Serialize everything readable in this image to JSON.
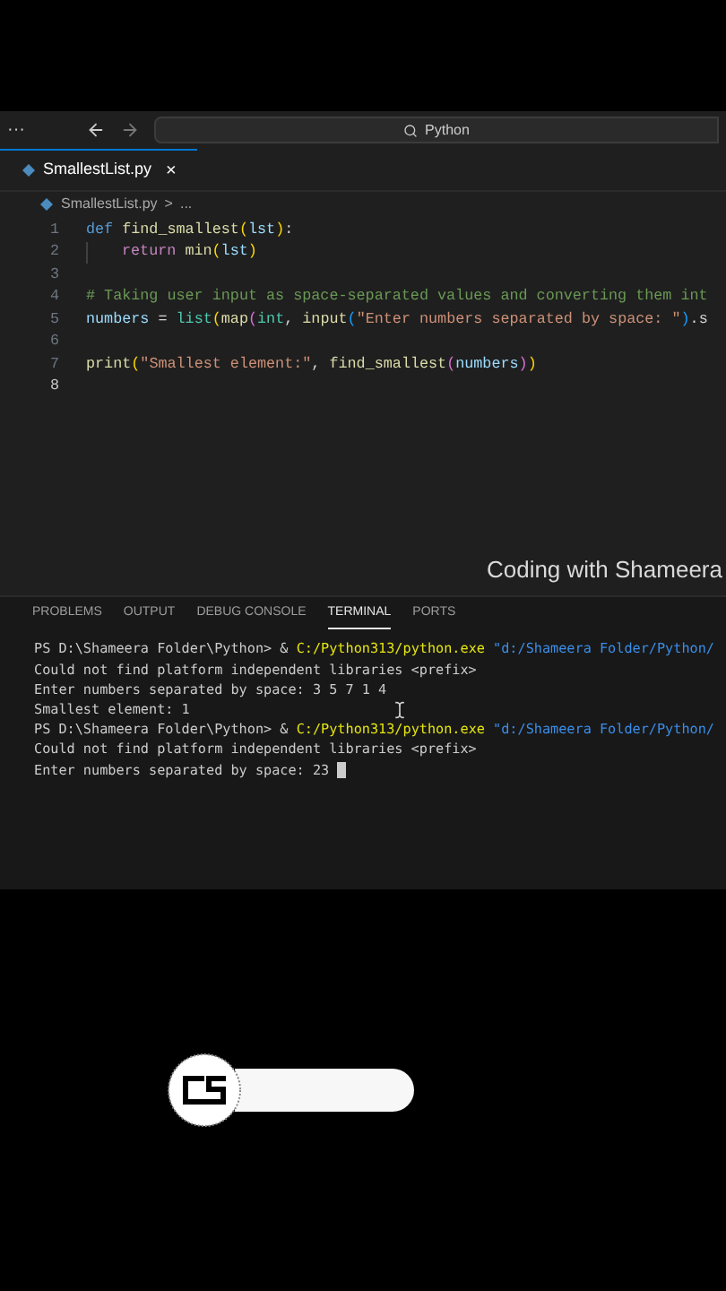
{
  "title_bar": {
    "menu": "···",
    "search": "Python"
  },
  "tabs": [
    {
      "label": "SmallestList.py",
      "selected": true,
      "close": "×"
    }
  ],
  "breadcrumb": {
    "file": "SmallestList.py",
    "separator": ">",
    "rest": "..."
  },
  "code": [
    {
      "number": "1",
      "current": false,
      "tokens": [
        {
          "kind": "keyword",
          "text": "def "
        },
        {
          "kind": "function",
          "text": "find_smallest"
        },
        {
          "kind": "bracket",
          "text": "("
        },
        {
          "kind": "variable",
          "text": "lst"
        },
        {
          "kind": "bracket",
          "text": ")"
        },
        {
          "kind": "plain",
          "text": ":"
        }
      ]
    },
    {
      "number": "2",
      "current": false,
      "indent": true,
      "tokens": [
        {
          "kind": "control",
          "text": "return "
        },
        {
          "kind": "function",
          "text": "min"
        },
        {
          "kind": "bracket",
          "text": "("
        },
        {
          "kind": "variable",
          "text": "lst"
        },
        {
          "kind": "bracket",
          "text": ")"
        }
      ]
    },
    {
      "number": "3",
      "current": false
    },
    {
      "number": "4",
      "current": false,
      "tokens": [
        {
          "kind": "comment",
          "text": "# Taking user input as space-separated values and converting them int"
        }
      ]
    },
    {
      "number": "5",
      "current": false,
      "tokens": [
        {
          "kind": "variable",
          "text": "numbers"
        },
        {
          "kind": "plain",
          "text": " = "
        },
        {
          "kind": "type",
          "text": "list"
        },
        {
          "kind": "bracket",
          "text": "("
        },
        {
          "kind": "function",
          "text": "map"
        },
        {
          "kind": "bracket2",
          "text": "("
        },
        {
          "kind": "type",
          "text": "int"
        },
        {
          "kind": "plain",
          "text": ", "
        },
        {
          "kind": "function",
          "text": "input"
        },
        {
          "kind": "bracket3",
          "text": "("
        },
        {
          "kind": "string",
          "text": "\"Enter numbers separated by space: \""
        },
        {
          "kind": "bracket3",
          "text": ")"
        },
        {
          "kind": "plain",
          "text": ".s"
        }
      ]
    },
    {
      "number": "6",
      "current": false
    },
    {
      "number": "7",
      "current": false,
      "tokens": [
        {
          "kind": "function",
          "text": "print"
        },
        {
          "kind": "bracket",
          "text": "("
        },
        {
          "kind": "string",
          "text": "\"Smallest element:\""
        },
        {
          "kind": "plain",
          "text": ", "
        },
        {
          "kind": "function",
          "text": "find_smallest"
        },
        {
          "kind": "bracket2",
          "text": "("
        },
        {
          "kind": "variable",
          "text": "numbers"
        },
        {
          "kind": "bracket2",
          "text": ")"
        },
        {
          "kind": "bracket",
          "text": ")"
        }
      ]
    },
    {
      "number": "8",
      "current": true
    }
  ],
  "caption": "Coding with Shameera",
  "panel_tabs": [
    {
      "label": "PROBLEMS",
      "selected": false
    },
    {
      "label": "OUTPUT",
      "selected": false
    },
    {
      "label": "DEBUG CONSOLE",
      "selected": false
    },
    {
      "label": "TERMINAL",
      "selected": true
    },
    {
      "label": "PORTS",
      "selected": false
    }
  ],
  "terminal": [
    [
      {
        "kind": "plain",
        "text": "PS D:\\Shameera Folder\\Python> & "
      },
      {
        "kind": "command",
        "text": "C:/Python313/python.exe"
      },
      {
        "kind": "string",
        "text": " \"d:/Shameera Folder/Python/"
      }
    ],
    [
      {
        "kind": "plain",
        "text": "Could not find platform independent libraries <prefix>"
      }
    ],
    [
      {
        "kind": "plain",
        "text": "Enter numbers separated by space: 3 5 7 1 4"
      }
    ],
    [
      {
        "kind": "plain",
        "text": "Smallest element: 1"
      }
    ],
    [
      {
        "kind": "plain",
        "text": "PS D:\\Shameera Folder\\Python> & "
      },
      {
        "kind": "command",
        "text": "C:/Python313/python.exe"
      },
      {
        "kind": "string",
        "text": " \"d:/Shameera Folder/Python/"
      }
    ],
    [
      {
        "kind": "plain",
        "text": "Could not find platform independent libraries <prefix>"
      }
    ],
    [
      {
        "kind": "plain",
        "text": "Enter numbers separated by space: 23 "
      },
      {
        "kind": "cursor"
      }
    ]
  ]
}
